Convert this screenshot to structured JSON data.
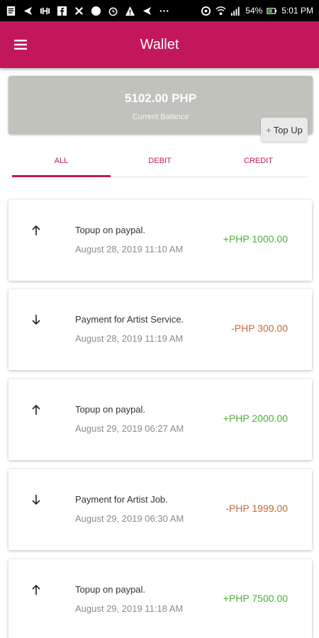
{
  "status_bar": {
    "battery": "54%",
    "time": "5:01 PM"
  },
  "app_bar": {
    "title": "Wallet",
    "menu_icon": "hamburger-menu-icon"
  },
  "balance": {
    "amount": "5102.00 PHP",
    "label": "Current Balance",
    "topup_plus": "+",
    "topup_label": "Top Up"
  },
  "tabs": [
    {
      "label": "ALL",
      "active": true
    },
    {
      "label": "DEBIT",
      "active": false
    },
    {
      "label": "CREDIT",
      "active": false
    }
  ],
  "colors": {
    "primary": "#c2185b",
    "credit": "#4caf3a",
    "debit": "#c26a3a",
    "balance_card": "#c2c2bd"
  },
  "transactions": [
    {
      "direction": "up",
      "icon": "arrow-up-icon",
      "title": "Topup on paypal.",
      "date": "August 28, 2019 11:10 AM",
      "amount": "+PHP 1000.00",
      "kind": "credit"
    },
    {
      "direction": "down",
      "icon": "arrow-down-icon",
      "title": "Payment for Artist Service.",
      "date": "August 28, 2019 11:19 AM",
      "amount": "-PHP 300.00",
      "kind": "debit"
    },
    {
      "direction": "up",
      "icon": "arrow-up-icon",
      "title": "Topup on paypal.",
      "date": "August 29, 2019 06:27 AM",
      "amount": "+PHP 2000.00",
      "kind": "credit"
    },
    {
      "direction": "down",
      "icon": "arrow-down-icon",
      "title": "Payment for Artist Job.",
      "date": "August 29, 2019 06:30 AM",
      "amount": "-PHP 1999.00",
      "kind": "debit"
    },
    {
      "direction": "up",
      "icon": "arrow-up-icon",
      "title": "Topup on paypal.",
      "date": "August 29, 2019 11:18 AM",
      "amount": "+PHP 7500.00",
      "kind": "credit"
    }
  ]
}
